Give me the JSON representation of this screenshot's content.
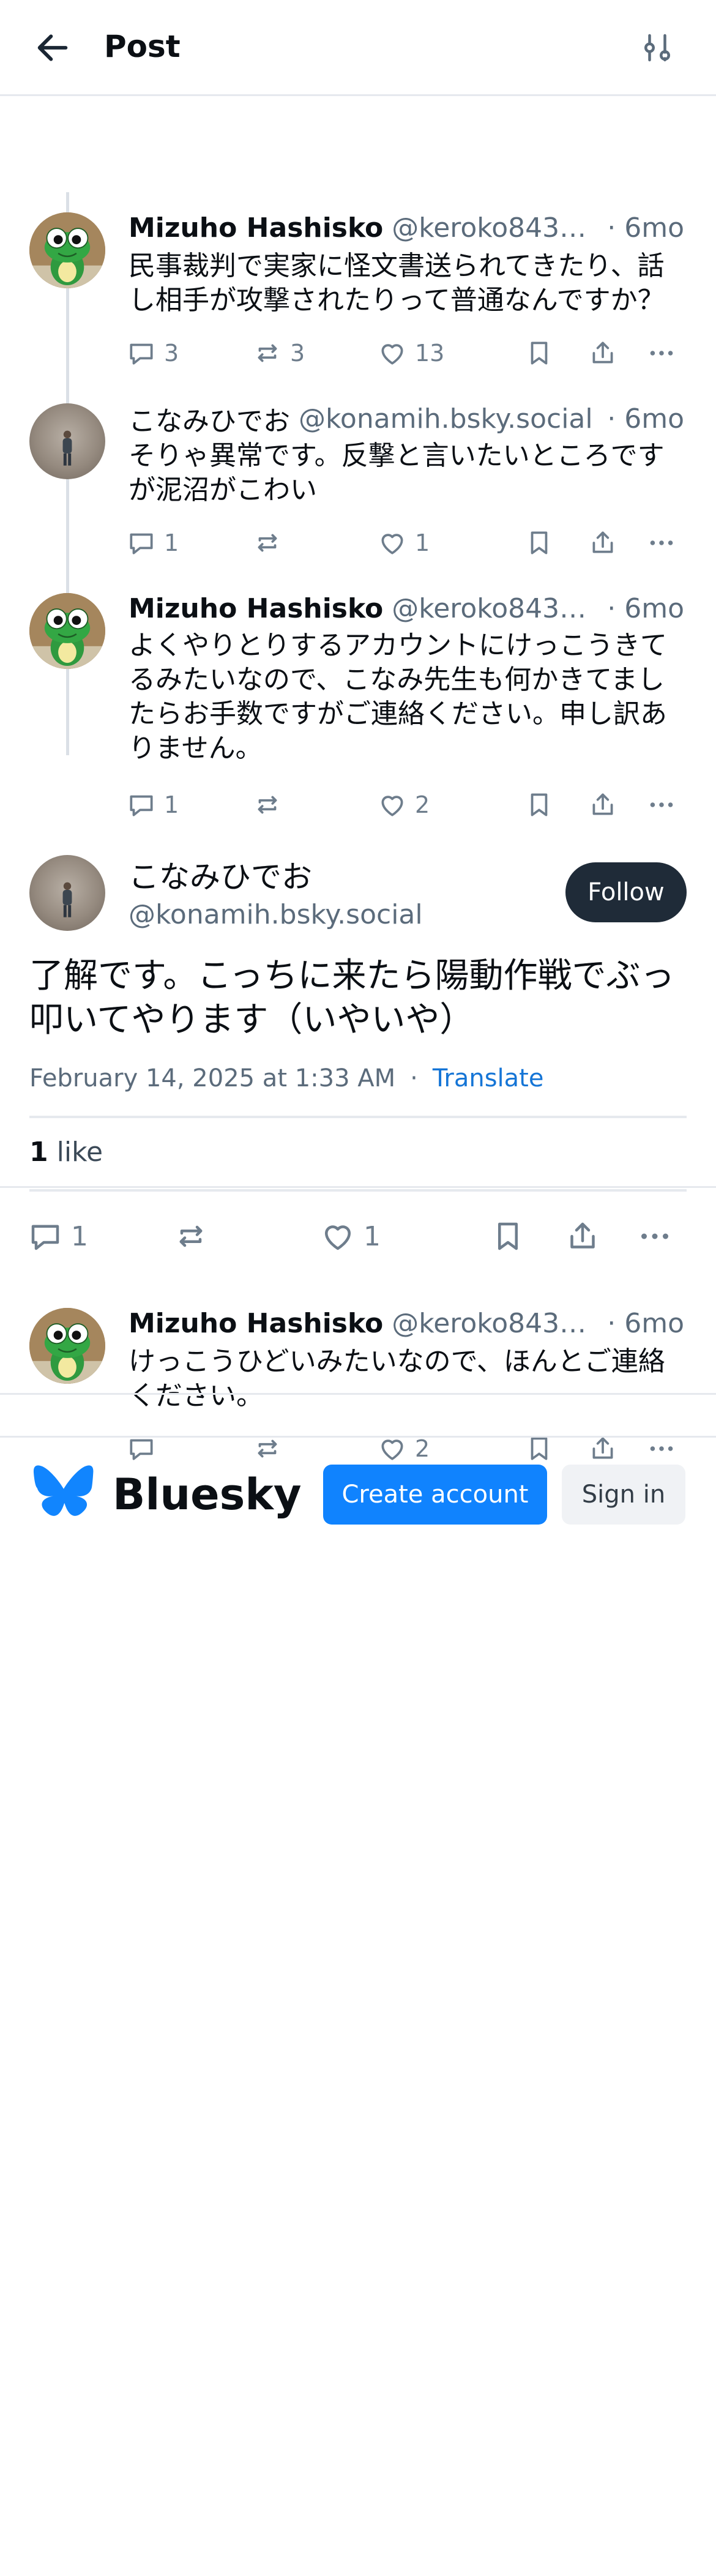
{
  "header": {
    "title": "Post"
  },
  "icons": {
    "back": "arrow-left-icon",
    "filter": "sliders-icon",
    "reply": "speech-bubble-icon",
    "repost": "repost-arrows-icon",
    "like": "heart-icon",
    "bookmark": "bookmark-icon",
    "share": "share-upload-icon",
    "more": "ellipsis-icon"
  },
  "thread": [
    {
      "name": "Mizuho Hashisko",
      "handle": "@keroko8435.b...",
      "time": "· 6mo",
      "text": "民事裁判で実家に怪文書送られてきたり、話し相手が攻撃されたりって普通なんですか？",
      "replies": "3",
      "reposts": "3",
      "likes": "13"
    },
    {
      "name": "こなみひでお",
      "handle": "@konamih.bsky.social",
      "time": "· 6mo",
      "text": "そりゃ異常です。反撃と言いたいところですが泥沼がこわい",
      "replies": "1",
      "reposts": "",
      "likes": "1"
    },
    {
      "name": "Mizuho Hashisko",
      "handle": "@keroko8435.b...",
      "time": "· 6mo",
      "text": "よくやりとりするアカウントにけっこうきてるみたいなので、こなみ先生も何かきてましたらお手数ですがご連絡ください。申し訳ありません。",
      "replies": "1",
      "reposts": "",
      "likes": "2"
    }
  ],
  "focus": {
    "name": "こなみひでお",
    "handle": "@konamih.bsky.social",
    "follow_label": "Follow",
    "text": "了解です。こっちに来たら陽動作戦でぶっ叩いてやります（いやいや）",
    "date": "February 14, 2025 at 1:33 AM",
    "dot": "·",
    "translate": "Translate",
    "like_count": "1",
    "like_word": "like",
    "replies": "1",
    "reposts": "",
    "likes": "1"
  },
  "reply_post": {
    "name": "Mizuho Hashisko",
    "handle": "@keroko8435.b...",
    "time": "· 6mo",
    "text": "けっこうひどいみたいなので、ほんとご連絡ください。",
    "replies": "",
    "reposts": "",
    "likes": "2"
  },
  "footer": {
    "brand": "Bluesky",
    "create_account": "Create account",
    "sign_in": "Sign in"
  },
  "colors": {
    "accent": "#1083fe",
    "link": "#1575d6",
    "follow_bg": "#1f2b38",
    "muted": "#5b6b7b"
  }
}
